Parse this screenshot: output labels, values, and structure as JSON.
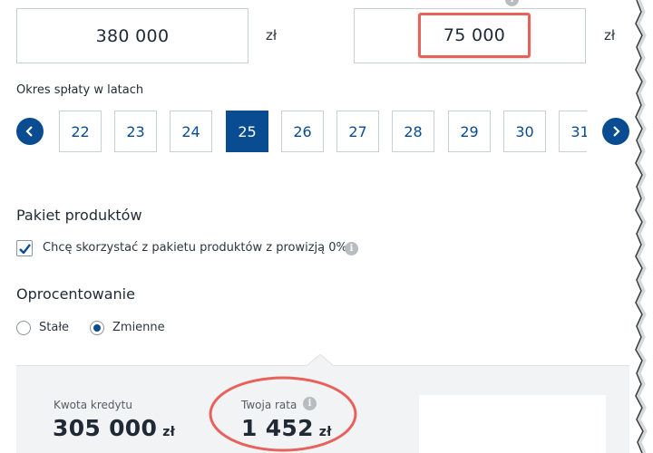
{
  "loan": {
    "property_value": "380 000",
    "property_unit": "zł",
    "own_contribution": "75 000",
    "own_unit": "zł"
  },
  "period": {
    "label": "Okres spłaty w latach",
    "years": [
      "22",
      "23",
      "24",
      "25",
      "26",
      "27",
      "28",
      "29",
      "30",
      "31"
    ],
    "selected": "25",
    "prev_icon": "chevron-left-icon",
    "next_icon": "chevron-right-icon"
  },
  "package": {
    "title": "Pakiet produktów",
    "checkbox_label": "Chcę skorzystać z pakietu produktów z prowizją 0%",
    "checked": true
  },
  "interest": {
    "title": "Oprocentowanie",
    "options": [
      "Stałe",
      "Zmienne"
    ],
    "selected": "Zmienne"
  },
  "summary": {
    "loan_amount_label": "Kwota kredytu",
    "loan_amount_value": "305 000",
    "loan_amount_unit": "zł",
    "rate_label": "Twoja rata",
    "rate_value": "1 452",
    "rate_unit": "zł"
  },
  "colors": {
    "accent": "#0a4c91",
    "highlight": "#e8625c"
  }
}
